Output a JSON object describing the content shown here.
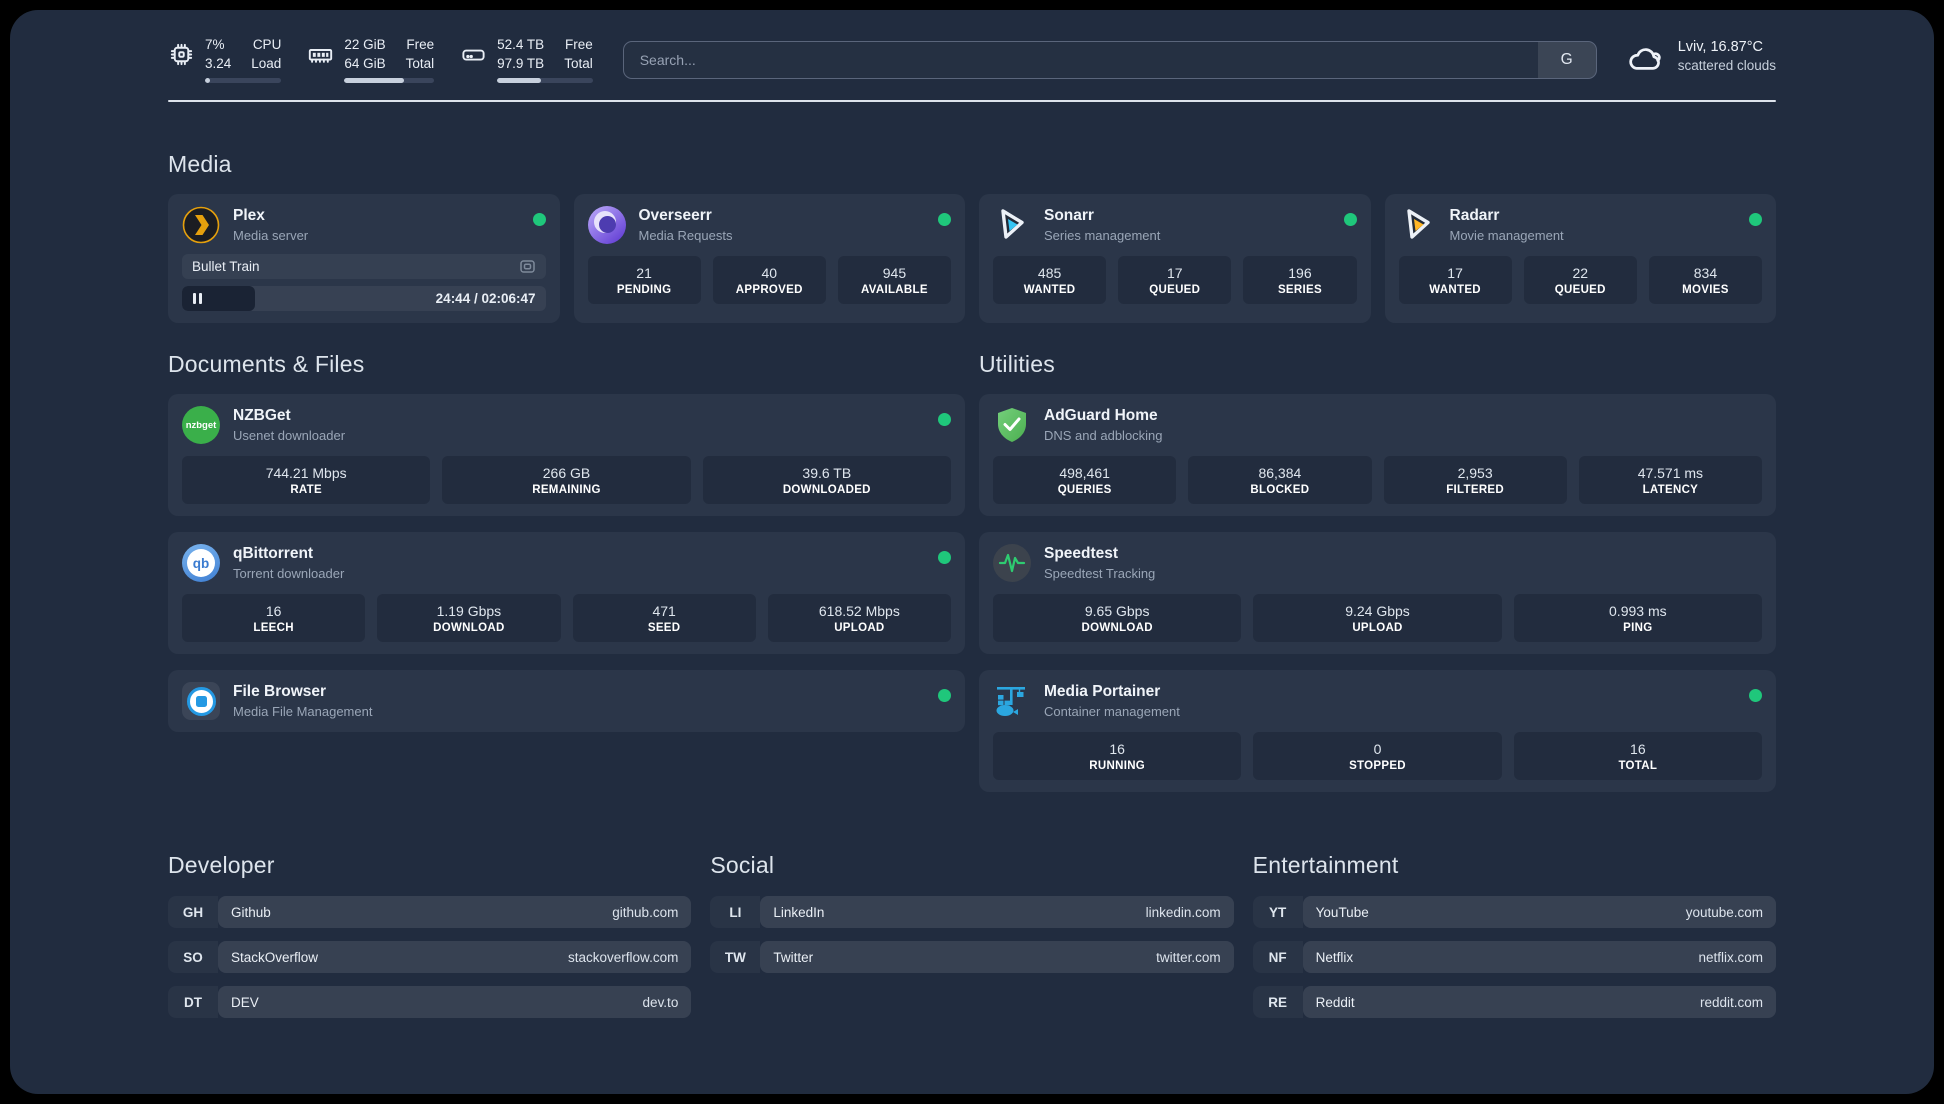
{
  "header": {
    "resources": [
      {
        "icon": "cpu-icon",
        "values": [
          "7%",
          "3.24"
        ],
        "labels": [
          "CPU",
          "Load"
        ],
        "percent": 7
      },
      {
        "icon": "memory-icon",
        "values": [
          "22 GiB",
          "64 GiB"
        ],
        "labels": [
          "Free",
          "Total"
        ],
        "percent": 66
      },
      {
        "icon": "disk-icon",
        "values": [
          "52.4 TB",
          "97.9 TB"
        ],
        "labels": [
          "Free",
          "Total"
        ],
        "percent": 46
      }
    ],
    "search": {
      "placeholder": "Search...",
      "button_label": "G"
    },
    "weather": {
      "location_temp": "Lviv, 16.87°C",
      "condition": "scattered clouds"
    }
  },
  "sections": {
    "media": "Media",
    "documents": "Documents & Files",
    "utilities": "Utilities",
    "developer": "Developer",
    "social": "Social",
    "entertainment": "Entertainment"
  },
  "apps": {
    "plex": {
      "name": "Plex",
      "subtitle": "Media server",
      "now_playing": {
        "title": "Bullet Train",
        "time": "24:44 / 02:06:47",
        "progress_percent": 20
      }
    },
    "overseerr": {
      "name": "Overseerr",
      "subtitle": "Media Requests",
      "stats": [
        {
          "value": "21",
          "label": "PENDING"
        },
        {
          "value": "40",
          "label": "APPROVED"
        },
        {
          "value": "945",
          "label": "AVAILABLE"
        }
      ]
    },
    "sonarr": {
      "name": "Sonarr",
      "subtitle": "Series management",
      "stats": [
        {
          "value": "485",
          "label": "WANTED"
        },
        {
          "value": "17",
          "label": "QUEUED"
        },
        {
          "value": "196",
          "label": "SERIES"
        }
      ]
    },
    "radarr": {
      "name": "Radarr",
      "subtitle": "Movie management",
      "stats": [
        {
          "value": "17",
          "label": "WANTED"
        },
        {
          "value": "22",
          "label": "QUEUED"
        },
        {
          "value": "834",
          "label": "MOVIES"
        }
      ]
    },
    "nzbget": {
      "name": "NZBGet",
      "subtitle": "Usenet downloader",
      "badge": "nzbget",
      "stats": [
        {
          "value": "744.21 Mbps",
          "label": "RATE"
        },
        {
          "value": "266 GB",
          "label": "REMAINING"
        },
        {
          "value": "39.6 TB",
          "label": "DOWNLOADED"
        }
      ]
    },
    "qbittorrent": {
      "name": "qBittorrent",
      "subtitle": "Torrent downloader",
      "badge": "qb",
      "stats": [
        {
          "value": "16",
          "label": "LEECH"
        },
        {
          "value": "1.19 Gbps",
          "label": "DOWNLOAD"
        },
        {
          "value": "471",
          "label": "SEED"
        },
        {
          "value": "618.52 Mbps",
          "label": "UPLOAD"
        }
      ]
    },
    "filebrowser": {
      "name": "File Browser",
      "subtitle": "Media File Management"
    },
    "adguard": {
      "name": "AdGuard Home",
      "subtitle": "DNS and adblocking",
      "stats": [
        {
          "value": "498,461",
          "label": "QUERIES"
        },
        {
          "value": "86,384",
          "label": "BLOCKED"
        },
        {
          "value": "2,953",
          "label": "FILTERED"
        },
        {
          "value": "47.571 ms",
          "label": "LATENCY"
        }
      ]
    },
    "speedtest": {
      "name": "Speedtest",
      "subtitle": "Speedtest Tracking",
      "stats": [
        {
          "value": "9.65 Gbps",
          "label": "DOWNLOAD"
        },
        {
          "value": "9.24 Gbps",
          "label": "UPLOAD"
        },
        {
          "value": "0.993 ms",
          "label": "PING"
        }
      ]
    },
    "portainer": {
      "name": "Media Portainer",
      "subtitle": "Container management",
      "stats": [
        {
          "value": "16",
          "label": "RUNNING"
        },
        {
          "value": "0",
          "label": "STOPPED"
        },
        {
          "value": "16",
          "label": "TOTAL"
        }
      ]
    }
  },
  "links": {
    "developer": [
      {
        "abbr": "GH",
        "name": "Github",
        "url": "github.com"
      },
      {
        "abbr": "SO",
        "name": "StackOverflow",
        "url": "stackoverflow.com"
      },
      {
        "abbr": "DT",
        "name": "DEV",
        "url": "dev.to"
      }
    ],
    "social": [
      {
        "abbr": "LI",
        "name": "LinkedIn",
        "url": "linkedin.com"
      },
      {
        "abbr": "TW",
        "name": "Twitter",
        "url": "twitter.com"
      }
    ],
    "entertainment": [
      {
        "abbr": "YT",
        "name": "YouTube",
        "url": "youtube.com"
      },
      {
        "abbr": "NF",
        "name": "Netflix",
        "url": "netflix.com"
      },
      {
        "abbr": "RE",
        "name": "Reddit",
        "url": "reddit.com"
      }
    ]
  },
  "colors": {
    "status_online": "#1fc77b",
    "page_bg": "#212c3f",
    "card_bg": "#2b3649",
    "plex_accent": "#e5a00d",
    "sonarr_accent": "#35c5f4",
    "radarr_accent": "#ffb626"
  }
}
